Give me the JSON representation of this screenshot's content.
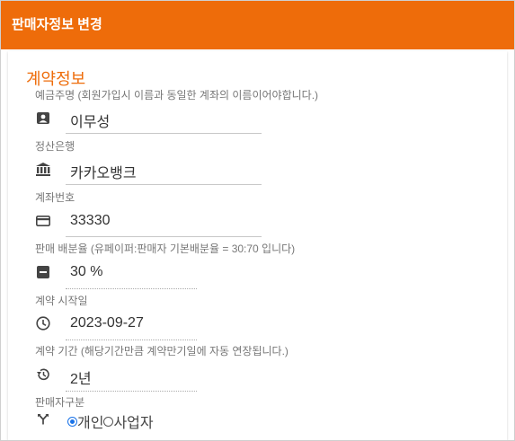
{
  "header": {
    "title": "판매자정보 변경"
  },
  "section": {
    "title": "계약정보"
  },
  "fields": {
    "holder": {
      "label": "예금주명 (회원가입시 이름과 동일한 계좌의 이름이어야합니다.)",
      "value": "이무성",
      "icon": "person-badge-icon"
    },
    "bank": {
      "label": "정산은행",
      "value": "카카오뱅크",
      "icon": "bank-icon"
    },
    "account": {
      "label": "계좌번호",
      "value": "33330",
      "icon": "credit-card-icon"
    },
    "ratio": {
      "label": "판매 배분율 (유페이퍼:판매자 기본배분율 = 30:70 입니다)",
      "value": "30 %",
      "icon": "minus-box-icon"
    },
    "start_date": {
      "label": "계약 시작일",
      "value": "2023-09-27",
      "icon": "clock-icon"
    },
    "period": {
      "label": "계약 기간 (해당기간만큼 계약만기일에 자동 연장됩니다.)",
      "value": "2년",
      "icon": "history-icon"
    },
    "seller_type": {
      "label": "판매자구분",
      "icon": "fork-icon",
      "options": [
        "개인",
        "사업자"
      ],
      "selected": "개인"
    }
  }
}
